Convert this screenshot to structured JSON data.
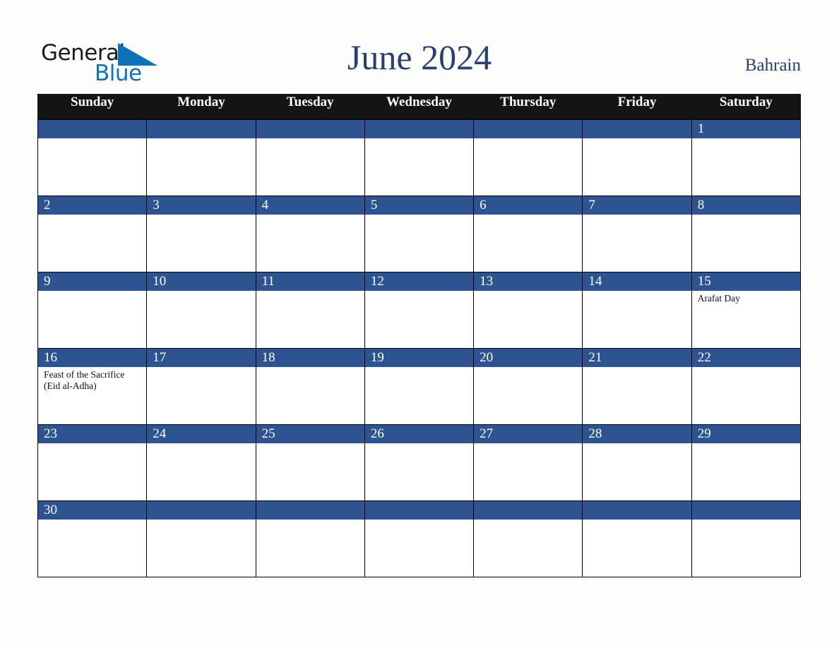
{
  "brand": {
    "name_part1": "General",
    "name_part2": "Blue",
    "triangle_color": "#0d72b9",
    "text_color": "#1a1a1a"
  },
  "header": {
    "title": "June 2024",
    "country": "Bahrain",
    "title_color": "#27406e"
  },
  "colors": {
    "header_row_bg": "#141414",
    "date_bar_bg": "#2d5490",
    "date_text": "#ffffff",
    "cell_bg": "#ffffff",
    "page_bg": "#fdfdfb",
    "border": "#000000"
  },
  "weekdays": [
    "Sunday",
    "Monday",
    "Tuesday",
    "Wednesday",
    "Thursday",
    "Friday",
    "Saturday"
  ],
  "weeks": [
    [
      {
        "date": "",
        "events": []
      },
      {
        "date": "",
        "events": []
      },
      {
        "date": "",
        "events": []
      },
      {
        "date": "",
        "events": []
      },
      {
        "date": "",
        "events": []
      },
      {
        "date": "",
        "events": []
      },
      {
        "date": "1",
        "events": []
      }
    ],
    [
      {
        "date": "2",
        "events": []
      },
      {
        "date": "3",
        "events": []
      },
      {
        "date": "4",
        "events": []
      },
      {
        "date": "5",
        "events": []
      },
      {
        "date": "6",
        "events": []
      },
      {
        "date": "7",
        "events": []
      },
      {
        "date": "8",
        "events": []
      }
    ],
    [
      {
        "date": "9",
        "events": []
      },
      {
        "date": "10",
        "events": []
      },
      {
        "date": "11",
        "events": []
      },
      {
        "date": "12",
        "events": []
      },
      {
        "date": "13",
        "events": []
      },
      {
        "date": "14",
        "events": []
      },
      {
        "date": "15",
        "events": [
          "Arafat Day"
        ]
      }
    ],
    [
      {
        "date": "16",
        "events": [
          "Feast of the Sacrifice (Eid al-Adha)"
        ]
      },
      {
        "date": "17",
        "events": []
      },
      {
        "date": "18",
        "events": []
      },
      {
        "date": "19",
        "events": []
      },
      {
        "date": "20",
        "events": []
      },
      {
        "date": "21",
        "events": []
      },
      {
        "date": "22",
        "events": []
      }
    ],
    [
      {
        "date": "23",
        "events": []
      },
      {
        "date": "24",
        "events": []
      },
      {
        "date": "25",
        "events": []
      },
      {
        "date": "26",
        "events": []
      },
      {
        "date": "27",
        "events": []
      },
      {
        "date": "28",
        "events": []
      },
      {
        "date": "29",
        "events": []
      }
    ],
    [
      {
        "date": "30",
        "events": []
      },
      {
        "date": "",
        "events": []
      },
      {
        "date": "",
        "events": []
      },
      {
        "date": "",
        "events": []
      },
      {
        "date": "",
        "events": []
      },
      {
        "date": "",
        "events": []
      },
      {
        "date": "",
        "events": []
      }
    ]
  ]
}
